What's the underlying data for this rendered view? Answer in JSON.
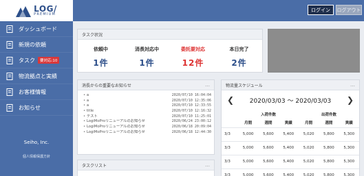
{
  "logo": {
    "main": "LOG/",
    "sub": "PREMIUM",
    "colors": {
      "primary": "#2d4f8a",
      "accent": "#8fa3c4"
    }
  },
  "header": {
    "login_label": "ログイン",
    "logout_label": "ログアウト"
  },
  "sidebar": {
    "items": [
      {
        "label": "ダッシュボード",
        "icon": "document-icon"
      },
      {
        "label": "新規の依頼",
        "icon": "document-icon"
      },
      {
        "label": "タスク",
        "icon": "document-icon",
        "badge": "要対応:10"
      },
      {
        "label": "物流拠点と実績",
        "icon": "document-icon"
      },
      {
        "label": "お客様情報",
        "icon": "document-icon"
      },
      {
        "label": "お知らせ",
        "icon": "document-icon"
      }
    ],
    "company": "Seiho, Inc.",
    "policy": "個人情報保護方針"
  },
  "task_status": {
    "title": "タスク状況",
    "stats": [
      {
        "label": "依頼中",
        "value": "1件"
      },
      {
        "label": "消長対応中",
        "value": "1件"
      },
      {
        "label": "委託要対応",
        "value": "12件",
        "alert": true
      },
      {
        "label": "本日完了",
        "value": "2件"
      }
    ]
  },
  "notices": {
    "title": "消長からの重要なお知らせ",
    "menu": "…",
    "items": [
      {
        "text": "a",
        "date": "2020/07/10 16:04:04"
      },
      {
        "text": "a",
        "date": "2020/07/10 12:35:06"
      },
      {
        "text": "a",
        "date": "2020/07/10 12:33:55"
      },
      {
        "text": "title",
        "date": "2020/07/10 12:16:32"
      },
      {
        "text": "テスト",
        "date": "2020/07/10 11:25:01"
      },
      {
        "text": "LogiMoProリニューアルのお知らせ",
        "date": "2020/06/24 23:00:12"
      },
      {
        "text": "LogiMoProリニューアルのお知らせ",
        "date": "2020/06/18 20:09:04"
      },
      {
        "text": "LogiMoProリニューアルのお知らせ",
        "date": "2020/06/18 12:44:30"
      }
    ]
  },
  "tasklist": {
    "title": "タスクリスト",
    "menu": "…"
  },
  "schedule": {
    "title": "物流量スケジュール",
    "menu": "…",
    "prev": "❮",
    "next": "❯",
    "range": "2020/03/03 ～ 2020/03/03",
    "group_headers": [
      "入荷件数",
      "出荷件数"
    ],
    "columns": [
      "月間",
      "週間",
      "実績",
      "月間",
      "週間",
      "実績"
    ],
    "rows": [
      {
        "date": "3/3",
        "values": [
          "5,000",
          "5,600",
          "5,400",
          "5,020",
          "5,800",
          "5,300"
        ]
      },
      {
        "date": "3/3",
        "values": [
          "5,000",
          "5,600",
          "5,400",
          "5,020",
          "5,800",
          "5,300"
        ]
      },
      {
        "date": "3/3",
        "values": [
          "5,000",
          "5,600",
          "5,400",
          "5,020",
          "5,800",
          "5,300"
        ]
      },
      {
        "date": "3/3",
        "values": [
          "5,000",
          "5,600",
          "5,400",
          "5,020",
          "5,800",
          "5,300"
        ]
      }
    ]
  }
}
